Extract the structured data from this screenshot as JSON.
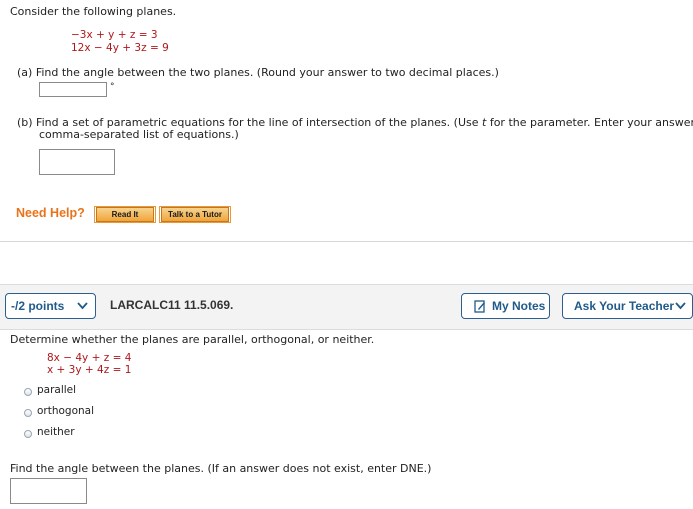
{
  "q1": {
    "intro": "Consider the following planes.",
    "eq1": "−3x + y + z = 3",
    "eq2": "12x − 4y + 3z = 9",
    "part_a": "(a)  Find the angle between the two planes. (Round your answer to two decimal places.)",
    "degree_symbol": "°",
    "part_b_line1_pre": "(b)  Find a set of parametric equations for the line of intersection of the planes. (Use ",
    "part_b_param": "t",
    "part_b_line1_post": " for the parameter. Enter your answers as a",
    "part_b_line2": "comma-separated list of equations.)"
  },
  "help": {
    "label": "Need Help?",
    "read_it": "Read It",
    "talk_to_tutor": "Talk to a Tutor"
  },
  "q2_header": {
    "points": "-/2 points",
    "problem_id": "LARCALC11 11.5.069.",
    "my_notes": "My Notes",
    "ask_teacher": "Ask Your Teacher"
  },
  "q2": {
    "prompt": "Determine whether the planes are parallel, orthogonal, or neither.",
    "eq1": "8x − 4y + z = 4",
    "eq2": "x + 3y + 4z = 1",
    "options": [
      "parallel",
      "orthogonal",
      "neither"
    ],
    "angle_prompt": "Find the angle between the planes. (If an answer does not exist, enter DNE.)"
  }
}
